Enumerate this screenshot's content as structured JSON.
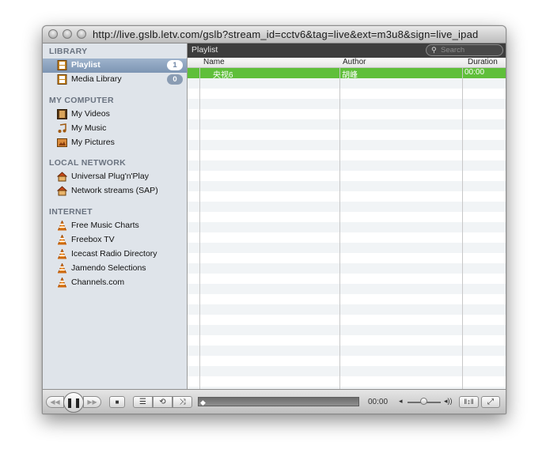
{
  "window": {
    "title": "http://live.gslb.letv.com/gslb?stream_id=cctv6&tag=live&ext=m3u8&sign=live_ipad"
  },
  "sidebar": {
    "library": {
      "heading": "LIBRARY",
      "items": [
        {
          "label": "Playlist",
          "icon": "playlist-icon",
          "badge": "1",
          "selected": true
        },
        {
          "label": "Media Library",
          "icon": "media-library-icon",
          "badge": "0",
          "selected": false
        }
      ]
    },
    "my_computer": {
      "heading": "MY COMPUTER",
      "items": [
        {
          "label": "My Videos",
          "icon": "film-icon"
        },
        {
          "label": "My Music",
          "icon": "music-note-icon"
        },
        {
          "label": "My Pictures",
          "icon": "picture-icon"
        }
      ]
    },
    "local_network": {
      "heading": "LOCAL NETWORK",
      "items": [
        {
          "label": "Universal Plug'n'Play",
          "icon": "house-icon"
        },
        {
          "label": "Network streams (SAP)",
          "icon": "house-icon"
        }
      ]
    },
    "internet": {
      "heading": "INTERNET",
      "items": [
        {
          "label": "Free Music Charts",
          "icon": "vlc-cone-icon"
        },
        {
          "label": "Freebox TV",
          "icon": "vlc-cone-icon"
        },
        {
          "label": "Icecast Radio Directory",
          "icon": "vlc-cone-icon"
        },
        {
          "label": "Jamendo Selections",
          "icon": "vlc-cone-icon"
        },
        {
          "label": "Channels.com",
          "icon": "vlc-cone-icon"
        }
      ]
    }
  },
  "playlist_bar": {
    "title": "Playlist",
    "search_placeholder": "Search"
  },
  "table": {
    "columns": [
      "Name",
      "Author",
      "Duration"
    ],
    "rows": [
      {
        "name": "央视6",
        "author": "胡峰",
        "duration": "00:00",
        "selected": true
      }
    ]
  },
  "controls": {
    "time": "00:00",
    "labels": {
      "prev": "◀◀",
      "play": "❚❚",
      "next": "▶▶",
      "stop": "■",
      "playlist": "☰",
      "repeat": "⟲",
      "shuffle": "⤨",
      "eq": "‖↕‖",
      "fullscreen": "⤢",
      "vol_min": "◂",
      "vol_max": "◂))"
    }
  },
  "colors": {
    "selection_green": "#5fbf3a",
    "sidebar_bg": "#dfe4ea",
    "header_dark": "#3d3d3d"
  }
}
